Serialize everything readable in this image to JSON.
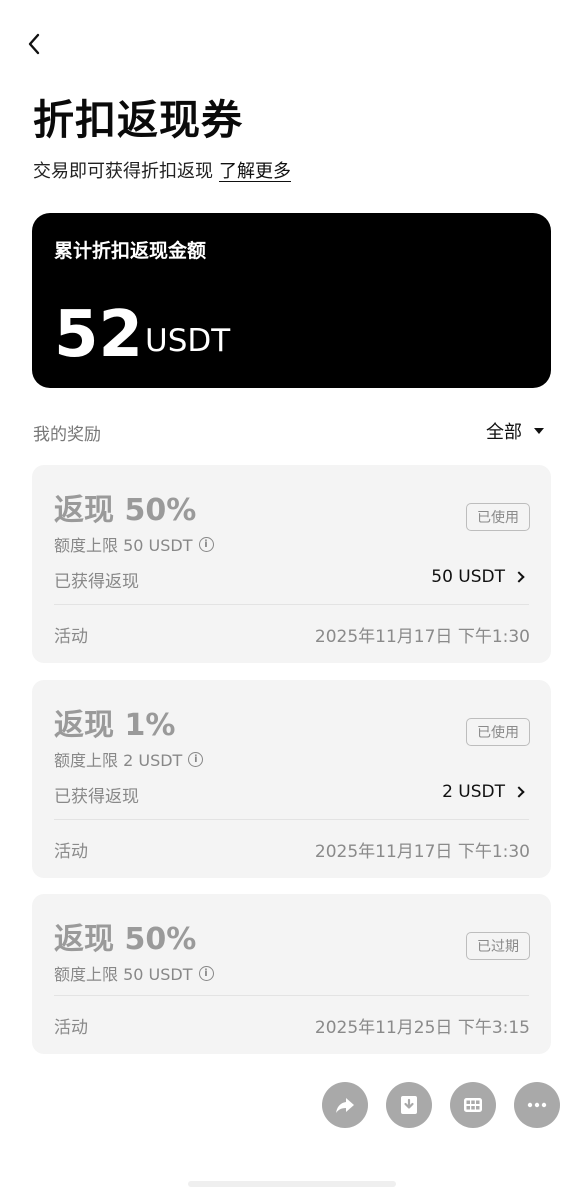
{
  "header": {
    "title": "折扣返现券",
    "subtitle": "交易即可获得折扣返现",
    "learn_more": "了解更多"
  },
  "summary": {
    "label": "累计折扣返现金额",
    "amount": "52",
    "unit": "USDT"
  },
  "rewards": {
    "label": "我的奖励",
    "filter": "全部",
    "items": [
      {
        "title": "返现 50%",
        "limit": "额度上限 50 USDT",
        "status": "已使用",
        "earned_label": "已获得返现",
        "earned_value": "50 USDT",
        "activity": "活动",
        "date": "2025年11月17日 下午1:30"
      },
      {
        "title": "返现 1%",
        "limit": "额度上限 2 USDT",
        "status": "已使用",
        "earned_label": "已获得返现",
        "earned_value": "2 USDT",
        "activity": "活动",
        "date": "2025年11月17日 下午1:30"
      },
      {
        "title": "返现 50%",
        "limit": "额度上限 50 USDT",
        "status": "已过期",
        "activity": "活动",
        "date": "2025年11月25日 下午3:15"
      }
    ]
  },
  "icons": {
    "back": "chevron-left-icon",
    "info": "info-icon",
    "share": "share-icon",
    "download": "download-icon",
    "grid": "grid-icon",
    "more": "more-icon"
  },
  "colors": {
    "summary_bg": "#000000",
    "card_bg": "#f4f4f4",
    "fab_bg": "#a9a9a9"
  }
}
